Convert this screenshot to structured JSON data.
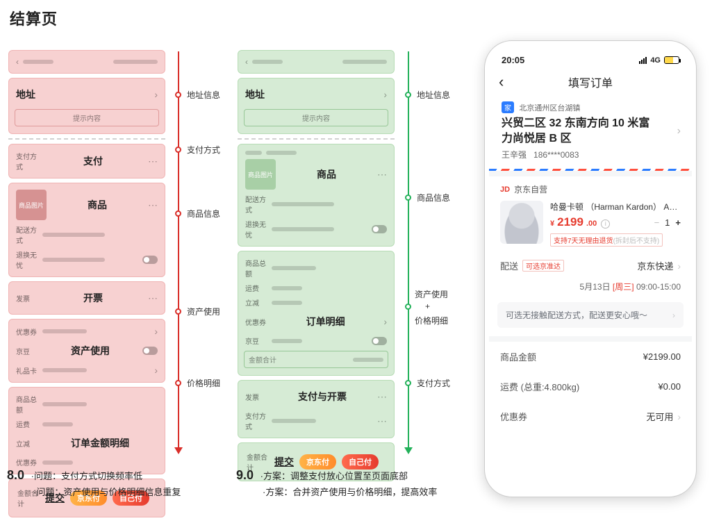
{
  "page_title": "结算页",
  "wf8": {
    "sections": {
      "address": "地址",
      "hint": "提示内容",
      "pay_label": "支付方式",
      "pay": "支付",
      "thumb": "商品图片",
      "goods": "商品",
      "delivery": "配送方式",
      "no_worry": "退换无忧",
      "invoice_label": "发票",
      "invoice": "开票",
      "coupon": "优惠券",
      "jingdou": "京豆",
      "gift": "礼品卡",
      "asset": "资产使用",
      "amt_goods": "商品总额",
      "amt_ship": "运费",
      "amt_disc": "立减",
      "amt_coupon": "优惠券",
      "amount": "订单金额明细",
      "total": "金额合计",
      "submit": "提交",
      "other_pay": "京东付",
      "self_pay": "自己付"
    },
    "annots": [
      "地址信息",
      "支付方式",
      "商品信息",
      "资产使用",
      "价格明细"
    ],
    "version": "8.0",
    "caption": [
      "·问题：支付方式切换频率低",
      "·问题：资产使用与价格明细信息重复"
    ]
  },
  "wf9": {
    "sections": {
      "address": "地址",
      "hint": "提示内容",
      "thumb": "商品图片",
      "goods": "商品",
      "delivery": "配送方式",
      "no_worry": "退换无忧",
      "amt_goods": "商品总额",
      "amt_ship": "运费",
      "amt_disc": "立减",
      "amt_coupon": "优惠券",
      "amt_jingdou": "京豆",
      "detail": "订单明细",
      "total_inner": "金额合计",
      "invoice_label": "发票",
      "pay_label": "支付方式",
      "pay_section": "支付与开票",
      "total": "金额合计",
      "submit": "提交",
      "other_pay": "京东付",
      "self_pay": "自己付"
    },
    "annots": [
      "地址信息",
      "商品信息",
      "资产使用",
      "+",
      "价格明细",
      "支付方式"
    ],
    "version": "9.0",
    "caption": [
      "·方案：调整支付放心位置至页面底部",
      "·方案：合并资产使用与价格明细，提高效率"
    ]
  },
  "phone": {
    "status": {
      "time": "20:05",
      "net": "4G"
    },
    "nav_title": "填写订单",
    "address": {
      "tag": "家",
      "region": "北京通州区台湖镇",
      "street": "兴贸二区 32 东南方向 10 米富力尚悦居 B 区",
      "name": "王辛强",
      "phone": "186****0083"
    },
    "shop": {
      "badge": "JD",
      "name": "京东自营"
    },
    "product": {
      "name": "哈曼卡顿 （Harman Kardon） Aura St...",
      "currency": "¥",
      "price_int": "2199",
      "price_dec": ".00",
      "return_main": "支持7天无理由退货",
      "return_sub": "(拆封后不支持)",
      "qty": "1"
    },
    "delivery": {
      "label": "配送",
      "tag": "可选京准达",
      "carrier": "京东快递",
      "date": "5月13日",
      "weekday": "[周三]",
      "window": "09:00-15:00"
    },
    "notice": "可选无接触配送方式，配送更安心哦～",
    "amounts": {
      "goods_label": "商品金额",
      "goods_value": "¥2199.00",
      "ship_label": "运费 (总重:4.800kg)",
      "ship_value": "¥0.00",
      "coupon_label": "优惠券",
      "coupon_value": "无可用"
    }
  }
}
